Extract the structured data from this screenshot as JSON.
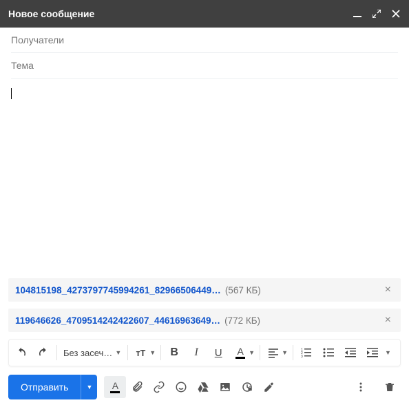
{
  "header": {
    "title": "Новое сообщение"
  },
  "fields": {
    "recipients_placeholder": "Получатели",
    "subject_placeholder": "Тема"
  },
  "attachments": [
    {
      "name": "104815198_4273797745994261_82966506449…",
      "size": "(567 КБ)"
    },
    {
      "name": "119646626_4709514242422607_44616963649…",
      "size": "(772 КБ)"
    }
  ],
  "format": {
    "font_label": "Без засеч…"
  },
  "footer": {
    "send_label": "Отправить"
  }
}
